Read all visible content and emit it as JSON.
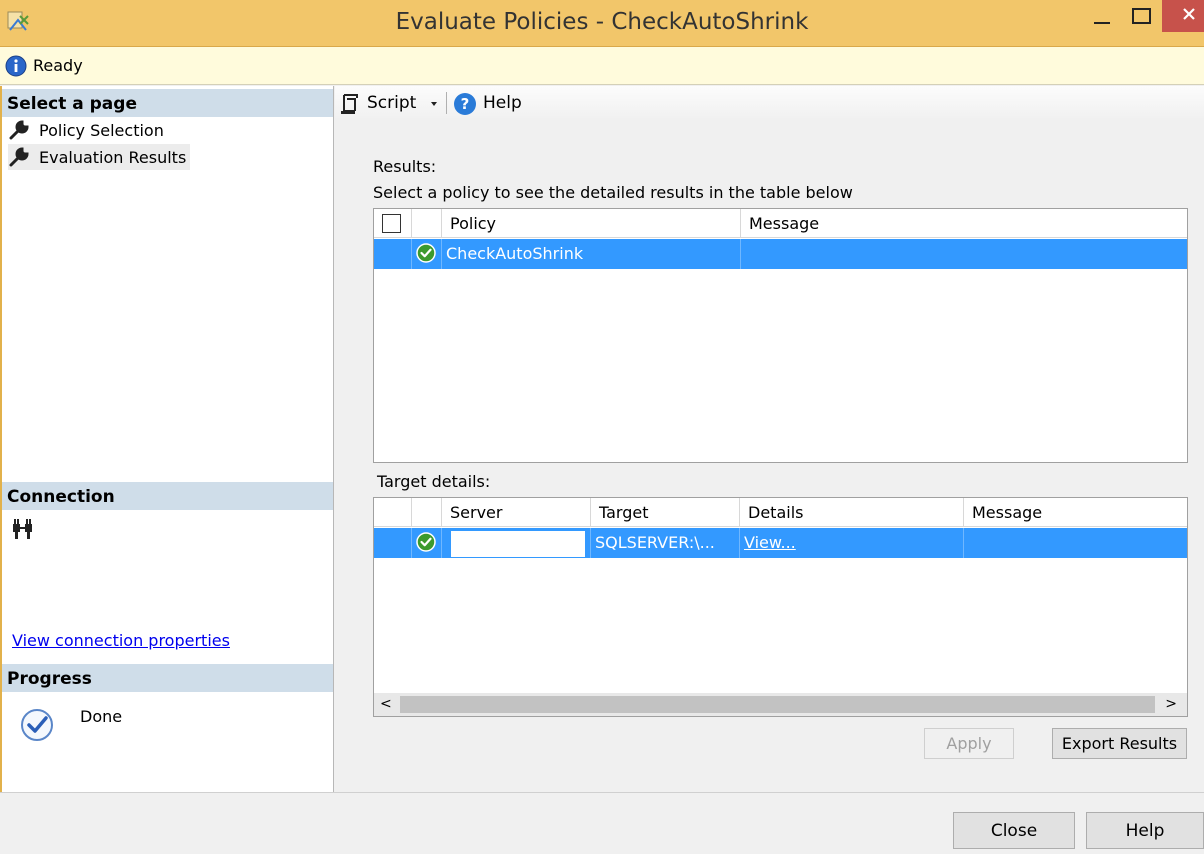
{
  "window": {
    "title": "Evaluate Policies - CheckAutoShrink",
    "minimize_glyph": "—",
    "maximize_glyph": "☐",
    "close_glyph": "✕"
  },
  "status": {
    "text": "Ready"
  },
  "sidebar": {
    "select_page_header": "Select a page",
    "pages": [
      {
        "label": "Policy Selection",
        "selected": false
      },
      {
        "label": "Evaluation Results",
        "selected": true
      }
    ],
    "connection_header": "Connection",
    "connection_link": "View connection properties",
    "progress_header": "Progress",
    "progress_text": "Done"
  },
  "toolbar": {
    "script_label": "Script",
    "help_label": "Help"
  },
  "results": {
    "label": "Results:",
    "instruction": "Select a policy to see the detailed results in the table below",
    "columns": [
      "Policy",
      "Message"
    ],
    "rows": [
      {
        "status": "success",
        "policy": "CheckAutoShrink",
        "message": ""
      }
    ]
  },
  "target_details": {
    "label": "Target details:",
    "columns": [
      "Server",
      "Target",
      "Details",
      "Message"
    ],
    "rows": [
      {
        "status": "success",
        "server": "",
        "target": "SQLSERVER:\\...",
        "details": "View...",
        "message": ""
      }
    ],
    "scroll_left": "<",
    "scroll_right": ">"
  },
  "buttons": {
    "apply": "Apply",
    "export": "Export Results",
    "close": "Close",
    "help": "Help"
  },
  "colors": {
    "titlebar": "#f2c66a",
    "selection": "#3399ff",
    "close_button": "#c7524b"
  }
}
